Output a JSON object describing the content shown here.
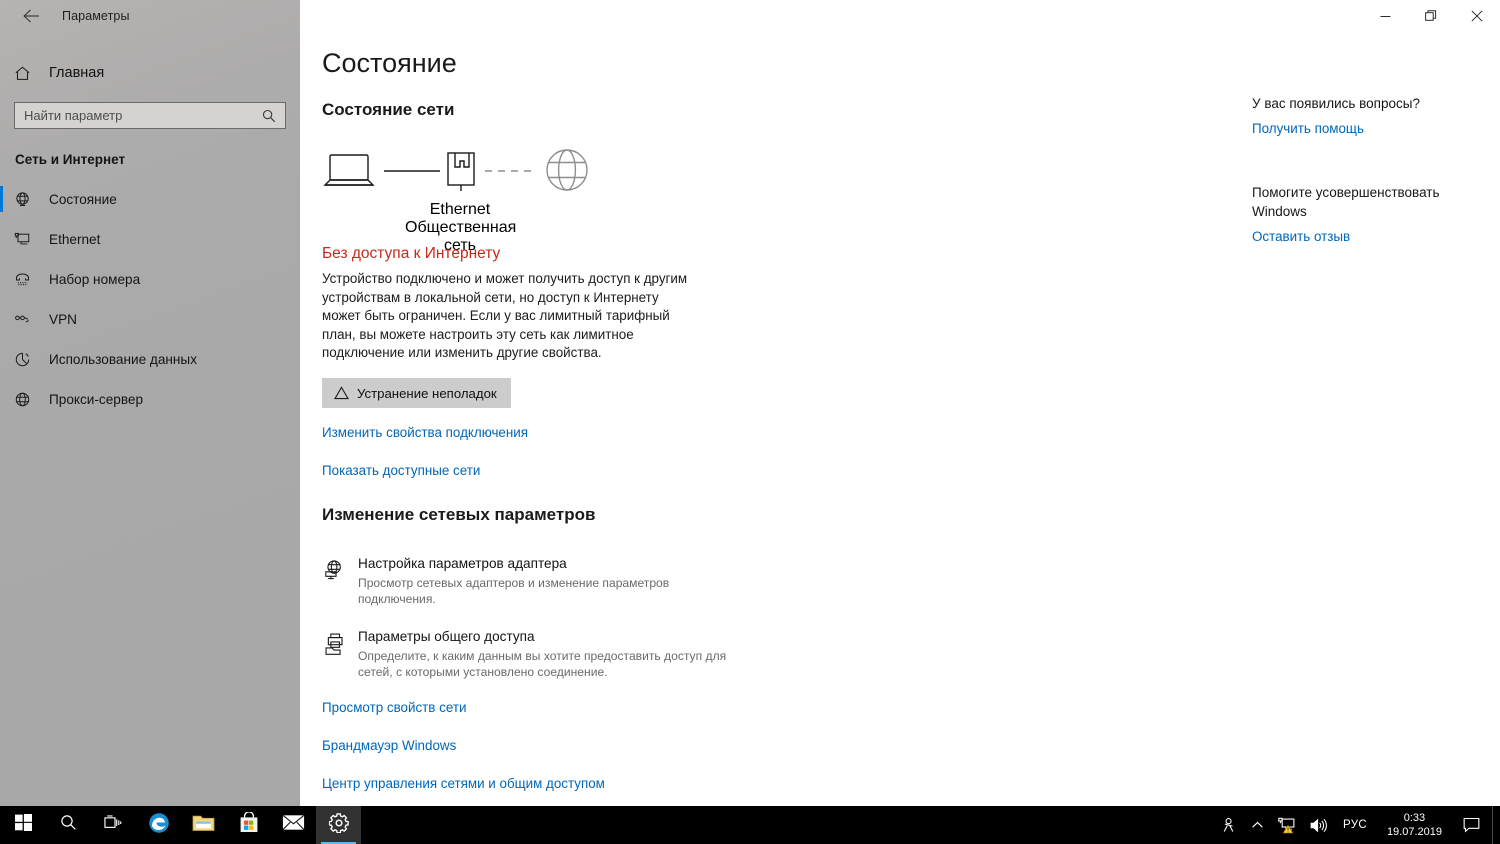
{
  "window": {
    "title": "Параметры",
    "back_icon": "back-arrow-icon",
    "controls": {
      "minimize": "minimize-icon",
      "restore": "restore-icon",
      "close": "close-icon"
    }
  },
  "sidebar": {
    "home": {
      "label": "Главная",
      "icon": "home-icon"
    },
    "search": {
      "placeholder": "Найти параметр",
      "value": "",
      "icon": "search-icon"
    },
    "category": "Сеть и Интернет",
    "accent_color": "#0078d7",
    "items": [
      {
        "label": "Состояние",
        "icon": "network-status-icon",
        "selected": true
      },
      {
        "label": "Ethernet",
        "icon": "ethernet-icon",
        "selected": false
      },
      {
        "label": "Набор номера",
        "icon": "dial-up-icon",
        "selected": false
      },
      {
        "label": "VPN",
        "icon": "vpn-icon",
        "selected": false
      },
      {
        "label": "Использование данных",
        "icon": "data-usage-icon",
        "selected": false
      },
      {
        "label": "Прокси-сервер",
        "icon": "proxy-icon",
        "selected": false
      }
    ]
  },
  "main": {
    "page_title": "Состояние",
    "network_status_heading": "Состояние сети",
    "diagram": {
      "device_icon": "laptop-icon",
      "adapter_icon": "ethernet-port-icon",
      "internet_icon": "globe-icon",
      "adapter_name": "Ethernet",
      "network_profile": "Общественная сеть",
      "link_device_to_adapter": "solid",
      "link_adapter_to_internet": "dashed"
    },
    "status": {
      "headline": "Без доступа к Интернету",
      "headline_color": "#c42b1c",
      "description": "Устройство подключено и может получить доступ к другим устройствам в локальной сети, но доступ к Интернету может быть ограничен. Если у вас лимитный тарифный план, вы можете настроить эту сеть как лимитное подключение или изменить другие свойства."
    },
    "troubleshoot_button": {
      "label": "Устранение неполадок",
      "icon": "warning-triangle-icon"
    },
    "links_top": [
      {
        "label": "Изменить свойства подключения"
      },
      {
        "label": "Показать доступные сети"
      }
    ],
    "change_params_heading": "Изменение сетевых параметров",
    "options": [
      {
        "title": "Настройка параметров адаптера",
        "desc": "Просмотр сетевых адаптеров и изменение параметров подключения.",
        "icon": "network-adapter-icon"
      },
      {
        "title": "Параметры общего доступа",
        "desc": "Определите, к каким данным вы хотите предоставить доступ для сетей, с которыми установлено соединение.",
        "icon": "sharing-printer-icon"
      }
    ],
    "links_bottom": [
      {
        "label": "Просмотр свойств сети"
      },
      {
        "label": "Брандмауэр Windows"
      },
      {
        "label": "Центр управления сетями и общим доступом"
      }
    ],
    "link_color": "#0067b8"
  },
  "help": {
    "question_heading": "У вас появились вопросы?",
    "question_link": "Получить помощь",
    "improve_heading": "Помогите усовершенствовать Windows",
    "improve_link": "Оставить отзыв"
  },
  "taskbar": {
    "items": [
      {
        "name": "start",
        "icon": "windows-logo-icon",
        "active": false
      },
      {
        "name": "search",
        "icon": "search-icon",
        "active": false
      },
      {
        "name": "task-view",
        "icon": "task-view-icon",
        "active": false
      },
      {
        "name": "edge",
        "icon": "edge-browser-icon",
        "active": false
      },
      {
        "name": "file-explorer",
        "icon": "folder-icon",
        "active": false
      },
      {
        "name": "microsoft-store",
        "icon": "store-bag-icon",
        "active": false
      },
      {
        "name": "mail",
        "icon": "envelope-icon",
        "active": false
      },
      {
        "name": "settings",
        "icon": "gear-icon",
        "active": true
      }
    ],
    "tray": {
      "people_icon": "people-icon",
      "overflow_icon": "chevron-up-icon",
      "network_icon": "network-warning-icon",
      "volume_icon": "speaker-icon",
      "language": "РУС",
      "time": "0:33",
      "date": "19.07.2019",
      "action_center_icon": "action-center-icon"
    }
  }
}
